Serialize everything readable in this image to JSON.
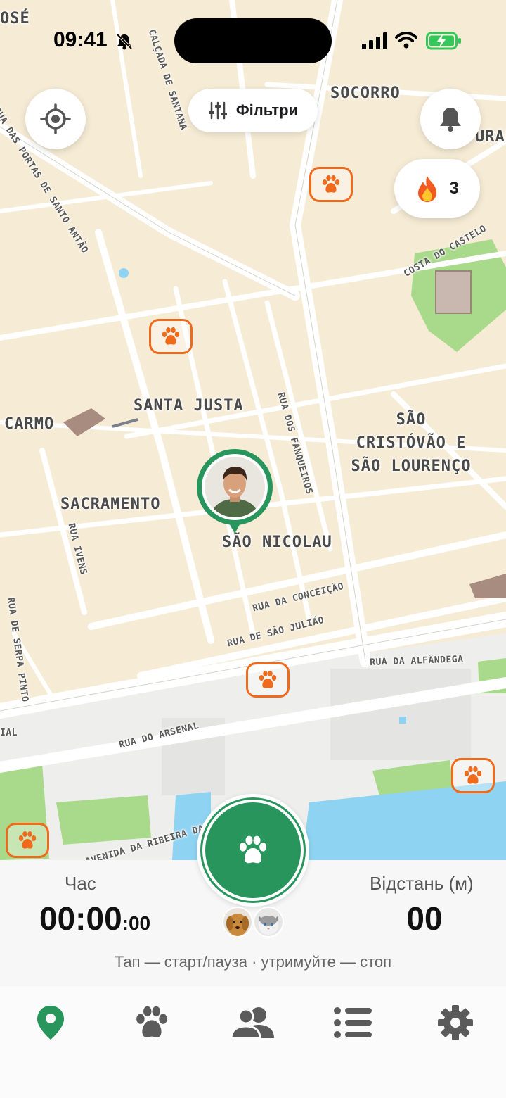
{
  "status_bar": {
    "time": "09:41",
    "icons": [
      "bell-slash-icon",
      "signal-icon",
      "wifi-icon",
      "battery-charging-icon"
    ]
  },
  "map": {
    "districts": [
      "SOCORRO",
      "SANTA JUSTA",
      "CARMO",
      "SÃO\nCRISTÓVÃO E\nSÃO LOURENÇO",
      "SACRAMENTO",
      "SÃO NICOLAU",
      "OSÉ",
      "URAR"
    ],
    "streets": [
      "RUA DAS PORTAS DE SANTO ANTÃO",
      "CALÇADA DE SANTANA",
      "COSTA DO CASTELO",
      "RUA DOS FANQUEIROS",
      "RUA IVENS",
      "RUA DE SERPA PINTO",
      "RUA DA CONCEIÇÃO",
      "RUA DE SÃO JULIÃO",
      "RUA DA ALFÂNDEGA",
      "RUA DO ARSENAL",
      "AVENIDA DA RIBEIRA DAS NAUS",
      "IAL"
    ],
    "colors": {
      "land": "#f6ecd6",
      "road": "#ffffff",
      "park": "#a9d98a",
      "water": "#8fd3f2",
      "paw_marker": "#f06a1c"
    }
  },
  "controls": {
    "locate_icon": "crosshair-icon",
    "filter_label": "Фільтри",
    "filter_icon": "sliders-icon",
    "notifications_icon": "bell-icon",
    "streak_icon": "fire-icon",
    "streak_count": "3"
  },
  "walk_panel": {
    "time_label": "Час",
    "time_main": "00:00",
    "time_fraction": ":00",
    "distance_label": "Відстань (м)",
    "distance_value": "00",
    "hint": "Тап — старт/пауза · утримуйте — стоп",
    "start_icon": "paw-icon",
    "pets": [
      "dog-avatar",
      "cat-avatar"
    ],
    "accent": "#27955c"
  },
  "tabs": [
    {
      "id": "map",
      "icon": "map-pin-icon",
      "active": true
    },
    {
      "id": "pets",
      "icon": "paw-icon",
      "active": false
    },
    {
      "id": "friends",
      "icon": "users-icon",
      "active": false
    },
    {
      "id": "list",
      "icon": "list-icon",
      "active": false
    },
    {
      "id": "settings",
      "icon": "gear-icon",
      "active": false
    }
  ]
}
